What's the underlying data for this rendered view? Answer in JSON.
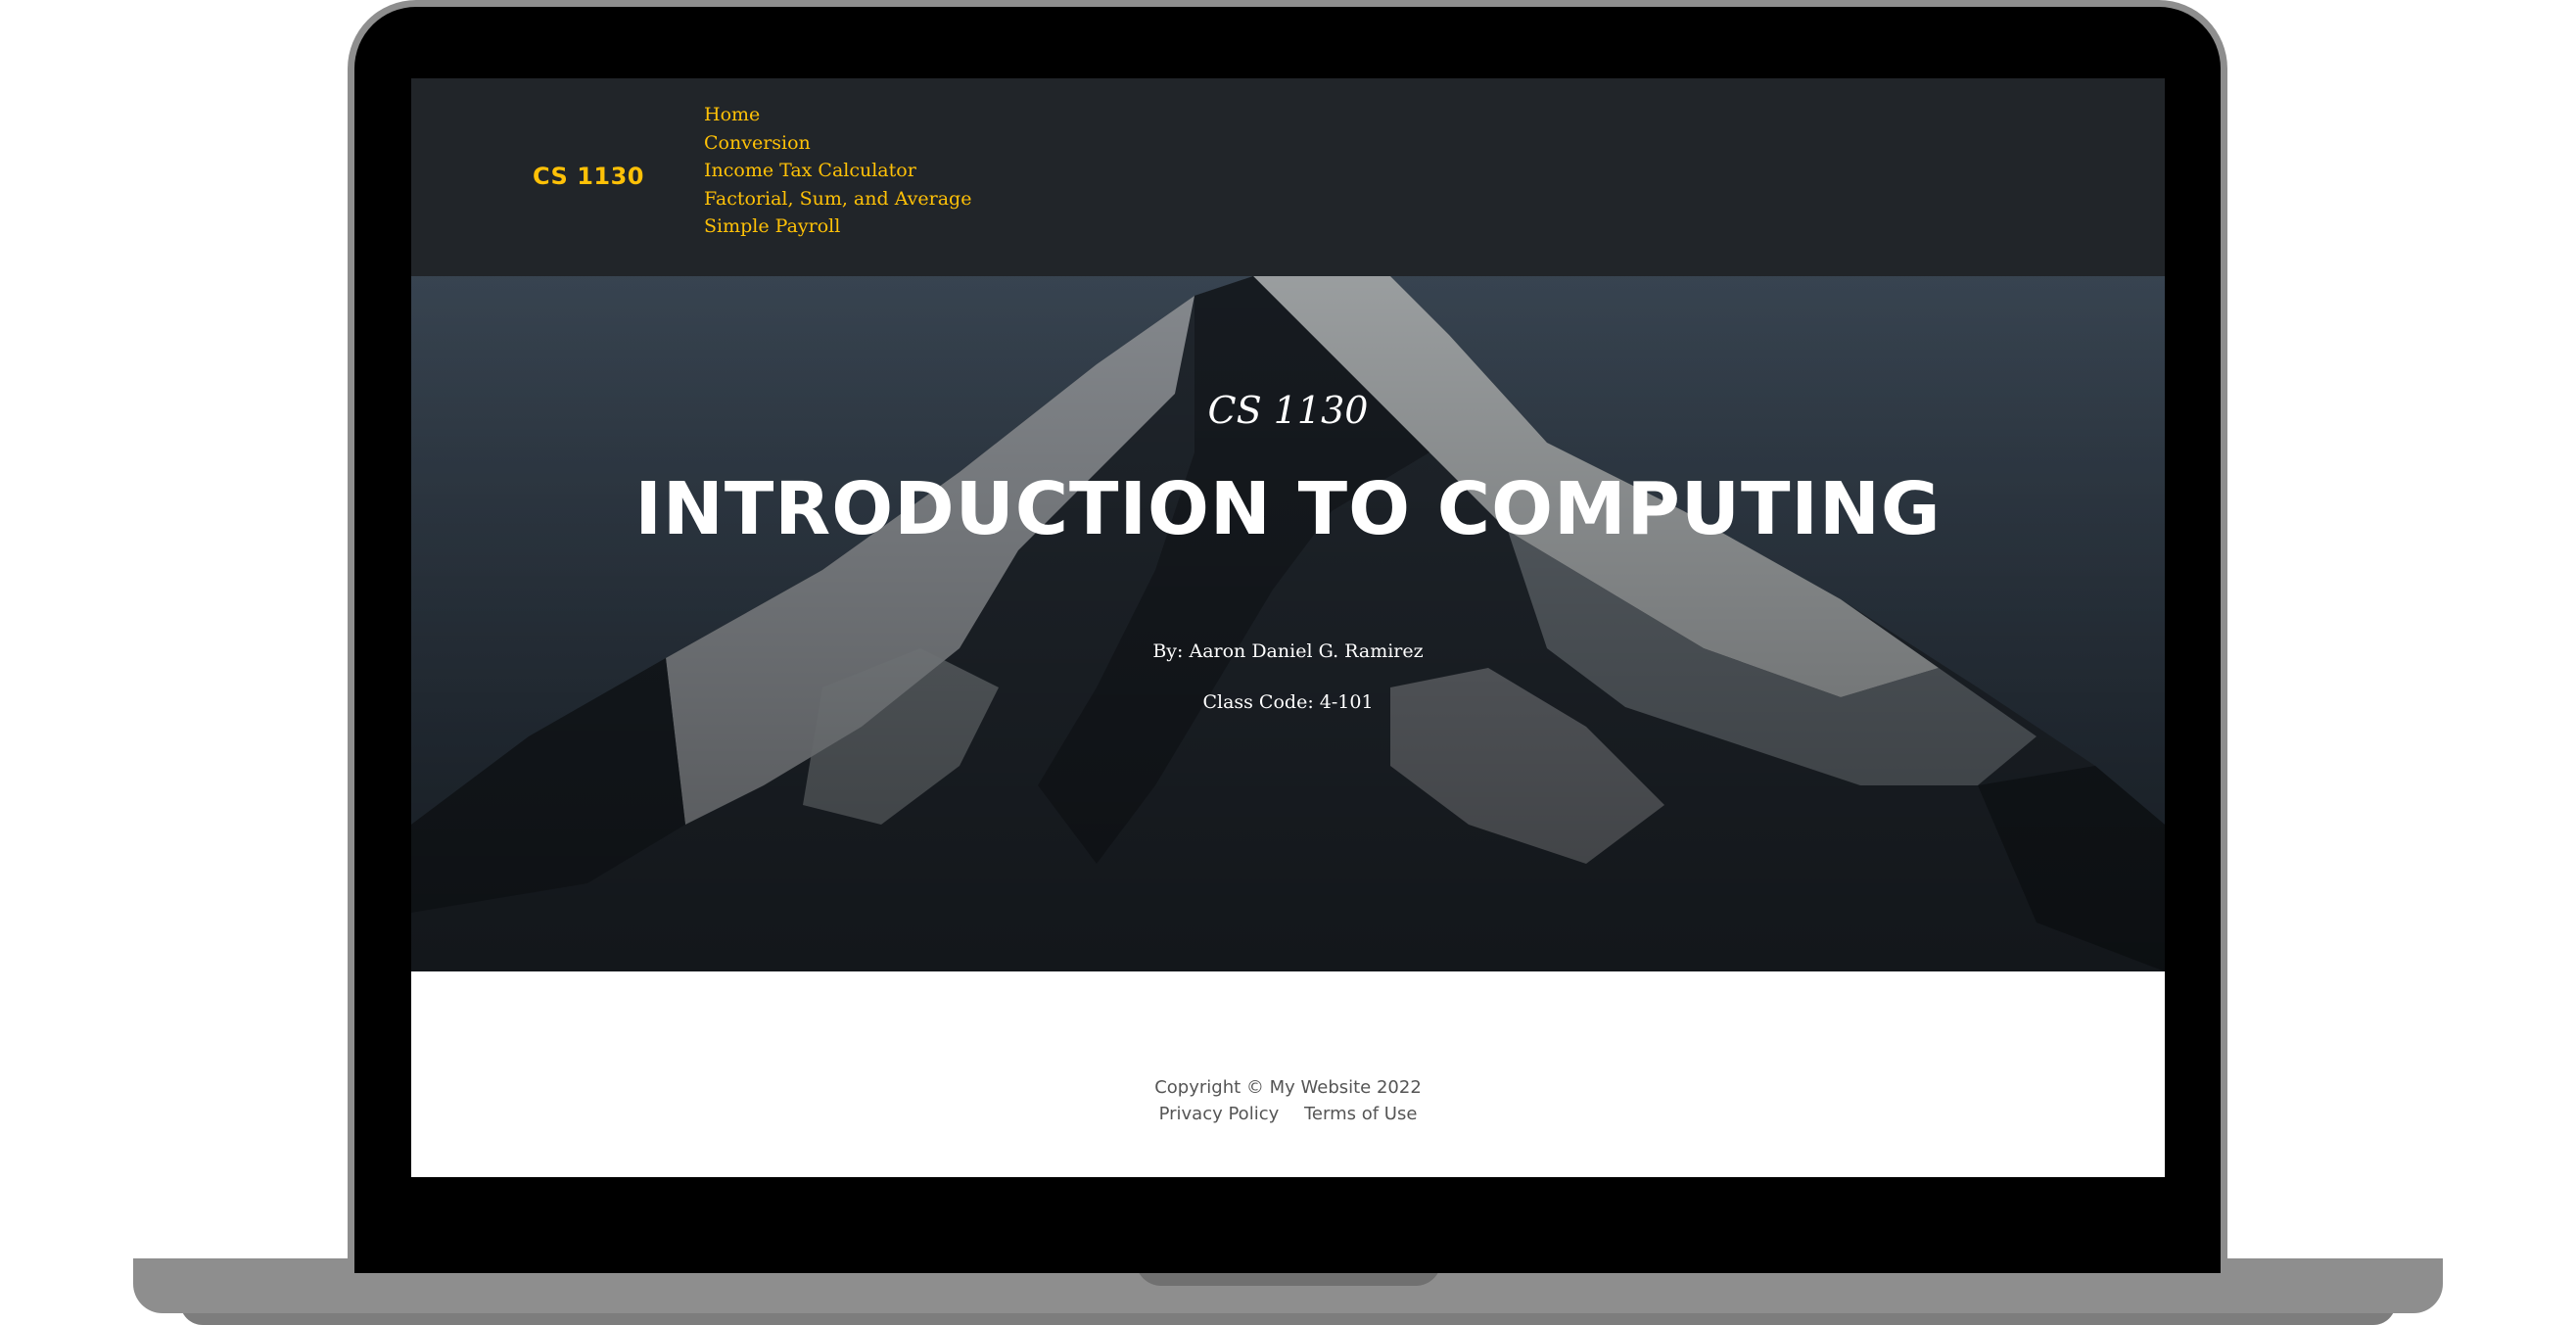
{
  "navbar": {
    "brand": "CS 1130",
    "links": [
      {
        "label": "Home"
      },
      {
        "label": "Conversion"
      },
      {
        "label": "Income Tax Calculator"
      },
      {
        "label": "Factorial, Sum, and Average"
      },
      {
        "label": "Simple Payroll"
      }
    ]
  },
  "hero": {
    "subtitle": "CS 1130",
    "title": "INTRODUCTION TO COMPUTING",
    "author": "By: Aaron Daniel G. Ramirez",
    "class_code": "Class Code: 4-101"
  },
  "footer": {
    "copyright": "Copyright © My Website 2022",
    "privacy": "Privacy Policy",
    "terms": "Terms of Use"
  },
  "colors": {
    "navbar_bg": "#212529",
    "accent": "#ffc107",
    "hero_sky": "#3b4a5a",
    "footer_text": "#555555"
  }
}
